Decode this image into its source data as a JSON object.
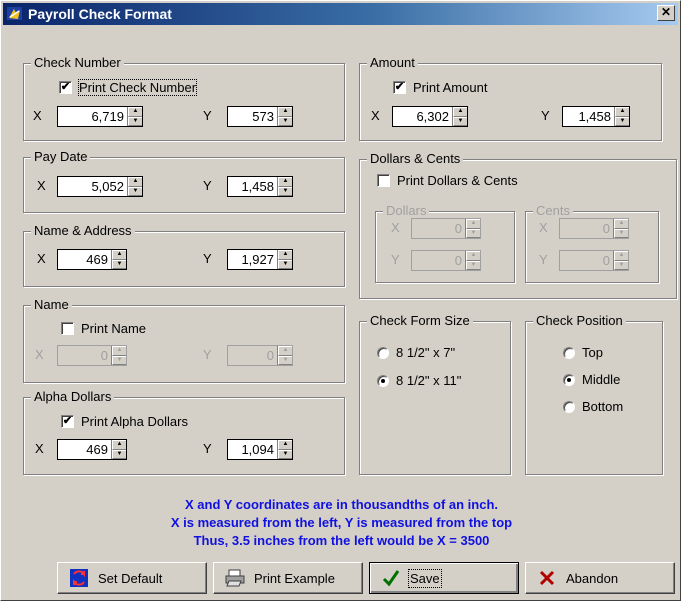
{
  "window": {
    "title": "Payroll Check Format",
    "close_glyph": "✕"
  },
  "check_number": {
    "legend": "Check Number",
    "checkbox_label": "Print Check Number",
    "checked": true,
    "x_label": "X",
    "x_value": "6,719",
    "y_label": "Y",
    "y_value": "573"
  },
  "amount": {
    "legend": "Amount",
    "checkbox_label": "Print Amount",
    "checked": true,
    "x_label": "X",
    "x_value": "6,302",
    "y_label": "Y",
    "y_value": "1,458"
  },
  "pay_date": {
    "legend": "Pay Date",
    "x_label": "X",
    "x_value": "5,052",
    "y_label": "Y",
    "y_value": "1,458"
  },
  "dollars_cents": {
    "legend": "Dollars & Cents",
    "checkbox_label": "Print Dollars & Cents",
    "checked": false,
    "dollars": {
      "legend": "Dollars",
      "x_label": "X",
      "x_value": "0",
      "y_label": "Y",
      "y_value": "0"
    },
    "cents": {
      "legend": "Cents",
      "x_label": "X",
      "x_value": "0",
      "y_label": "Y",
      "y_value": "0"
    }
  },
  "name_address": {
    "legend": "Name & Address",
    "x_label": "X",
    "x_value": "469",
    "y_label": "Y",
    "y_value": "1,927"
  },
  "name": {
    "legend": "Name",
    "checkbox_label": "Print Name",
    "checked": false,
    "x_label": "X",
    "x_value": "0",
    "y_label": "Y",
    "y_value": "0"
  },
  "alpha_dollars": {
    "legend": "Alpha Dollars",
    "checkbox_label": "Print Alpha Dollars",
    "checked": true,
    "x_label": "X",
    "x_value": "469",
    "y_label": "Y",
    "y_value": "1,094"
  },
  "check_form_size": {
    "legend": "Check Form Size",
    "options": [
      "8 1/2\" x 7\"",
      "8 1/2\" x 11\""
    ],
    "selected": "8 1/2\" x 11\""
  },
  "check_position": {
    "legend": "Check Position",
    "options": [
      "Top",
      "Middle",
      "Bottom"
    ],
    "selected": "Middle"
  },
  "notes": {
    "line1": "X and Y coordinates are in thousandths of an inch.",
    "line2": "X is measured from the left, Y is measured from the top",
    "line3": "Thus, 3.5 inches from the left would be X = 3500"
  },
  "buttons": {
    "set_default": "Set Default",
    "print_example": "Print Example",
    "save": "Save",
    "abandon": "Abandon"
  },
  "colors": {
    "note_text": "#1010e0",
    "titlebar_start": "#0a246a",
    "titlebar_end": "#a6caf0",
    "abandon_x": "#b00000",
    "save_check": "#007000"
  },
  "icons": {
    "app": "app-icon",
    "set_default": "refresh-arrows-icon",
    "print_example": "printer-icon",
    "save": "checkmark-icon",
    "abandon": "x-mark-icon"
  },
  "check_mark": "✔",
  "spin_up": "▲",
  "spin_down": "▼"
}
